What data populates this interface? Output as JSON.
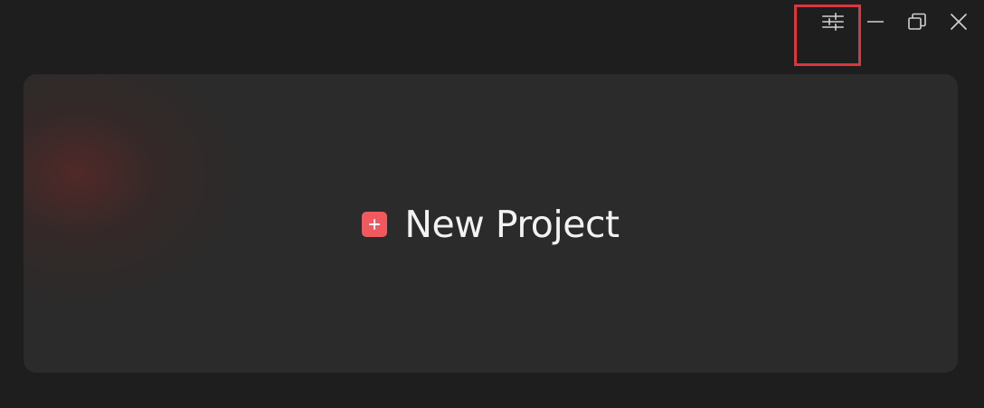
{
  "window": {
    "controls": {
      "settings_icon": "sliders-icon",
      "minimize_icon": "minimize-icon",
      "maximize_icon": "restore-icon",
      "close_icon": "close-icon"
    }
  },
  "main": {
    "new_project": {
      "label": "New Project",
      "icon": "plus-icon"
    }
  },
  "colors": {
    "background": "#1e1e1e",
    "card": "#2b2b2b",
    "accent": "#f0595e",
    "highlight_box": "#d9363e",
    "text": "#f2f2f2",
    "icon": "#d0d0d0"
  }
}
